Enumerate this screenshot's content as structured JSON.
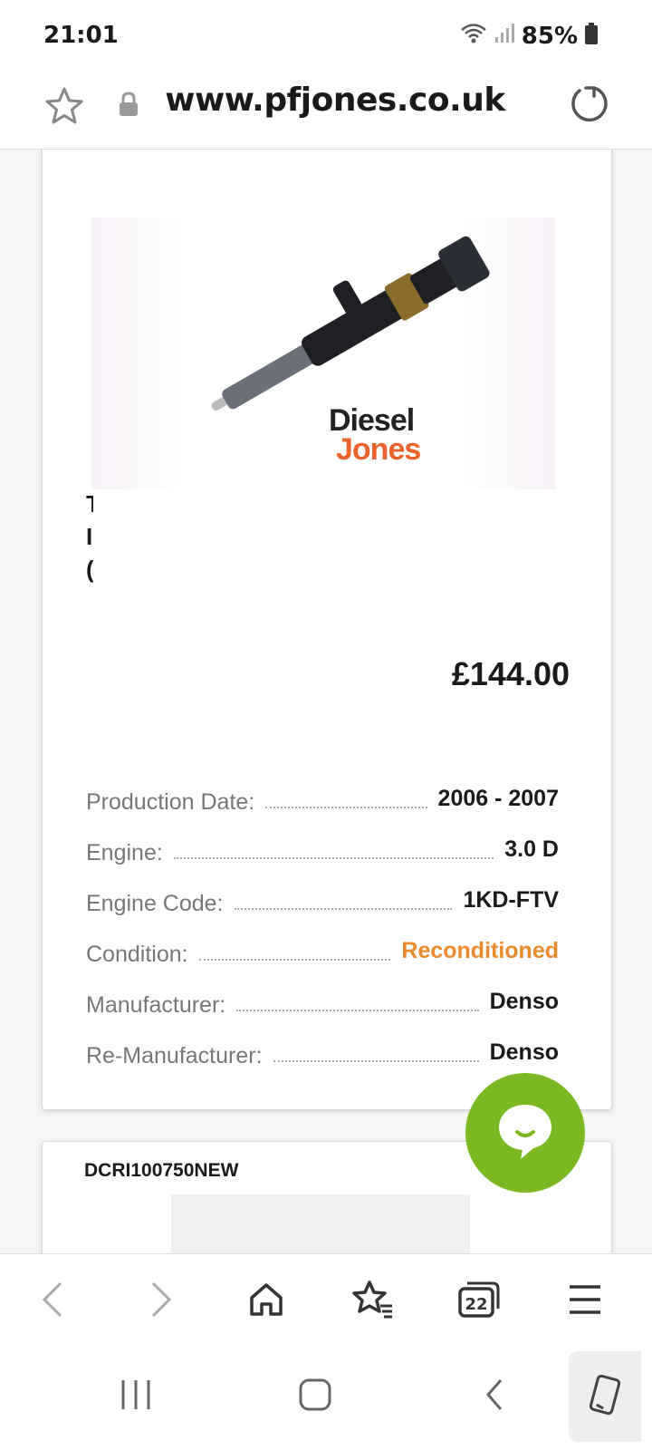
{
  "status_bar": {
    "time": "21:01",
    "battery": "85%"
  },
  "url_bar": {
    "url": "www.pfjones.co.uk"
  },
  "product": {
    "watermark_line1": "Diesel",
    "watermark_line2": "Jones",
    "title_fragment_lines": [
      "T",
      "I",
      "("
    ],
    "price": "£144.00",
    "specs": [
      {
        "label": "Production Date:",
        "value": "2006 - 2007"
      },
      {
        "label": "Engine:",
        "value": "3.0 D"
      },
      {
        "label": "Engine Code:",
        "value": "1KD-FTV"
      },
      {
        "label": "Condition:",
        "value": "Reconditioned"
      },
      {
        "label": "Manufacturer:",
        "value": "Denso"
      },
      {
        "label": "Re-Manufacturer:",
        "value": "Denso"
      }
    ]
  },
  "next_product": {
    "sku": "DCRI100750NEW"
  },
  "toolbar": {
    "tabs_count": "22"
  },
  "colors": {
    "accent_orange": "#e98a2c",
    "chat_green": "#7cb822"
  }
}
